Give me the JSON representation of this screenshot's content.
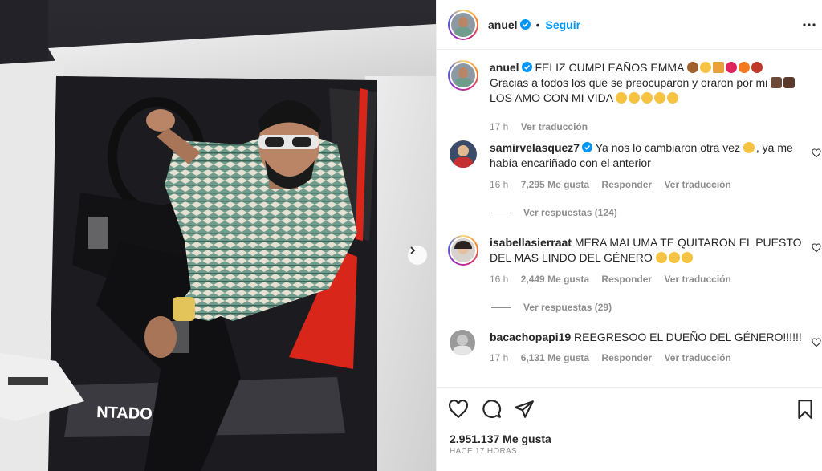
{
  "post": {
    "username": "anuel",
    "follow_label": "Seguir",
    "separator": "•",
    "caption_line1": "FELIZ CUMPLEAÑOS EMMA",
    "caption_line2": "Gracias a todos los que se preocuparon y oraron por mi",
    "caption_line3": "LOS AMO CON MI VIDA",
    "caption_time": "17 h",
    "caption_translate": "Ver traducción",
    "likes": "2.951.137 Me gusta",
    "time_ago": "HACE 17 HORAS"
  },
  "comments": [
    {
      "username": "samirvelasquez7",
      "text_a": "Ya nos lo cambiaron otra vez",
      "text_b": ", ya me había encariñado con el anterior",
      "time": "16 h",
      "likes": "7,295 Me gusta",
      "reply": "Responder",
      "translate": "Ver traducción",
      "view_replies": "Ver respuestas (124)"
    },
    {
      "username": "isabellasierraat",
      "text": "MERA MALUMA TE QUITARON EL PUESTO DEL MAS LINDO DEL GÉNERO",
      "time": "16 h",
      "likes": "2,449 Me gusta",
      "reply": "Responder",
      "translate": "Ver traducción",
      "view_replies": "Ver respuestas (29)"
    },
    {
      "username": "bacachopapi19",
      "text": "REEGRESOO EL DUEÑO DEL GÉNERO!!!!!!",
      "time": "17 h",
      "likes": "6,131 Me gusta",
      "reply": "Responder",
      "translate": "Ver traducción"
    }
  ],
  "icons": {
    "verified": "verified-badge-icon",
    "more": "more-options-icon",
    "like": "heart-icon",
    "comment": "comment-icon",
    "share": "share-icon",
    "save": "bookmark-icon",
    "next": "chevron-right-icon"
  },
  "colors": {
    "link_blue": "#0095f6",
    "meta_gray": "#8e8e8e",
    "text": "#262626",
    "car_red": "#d8261b"
  }
}
